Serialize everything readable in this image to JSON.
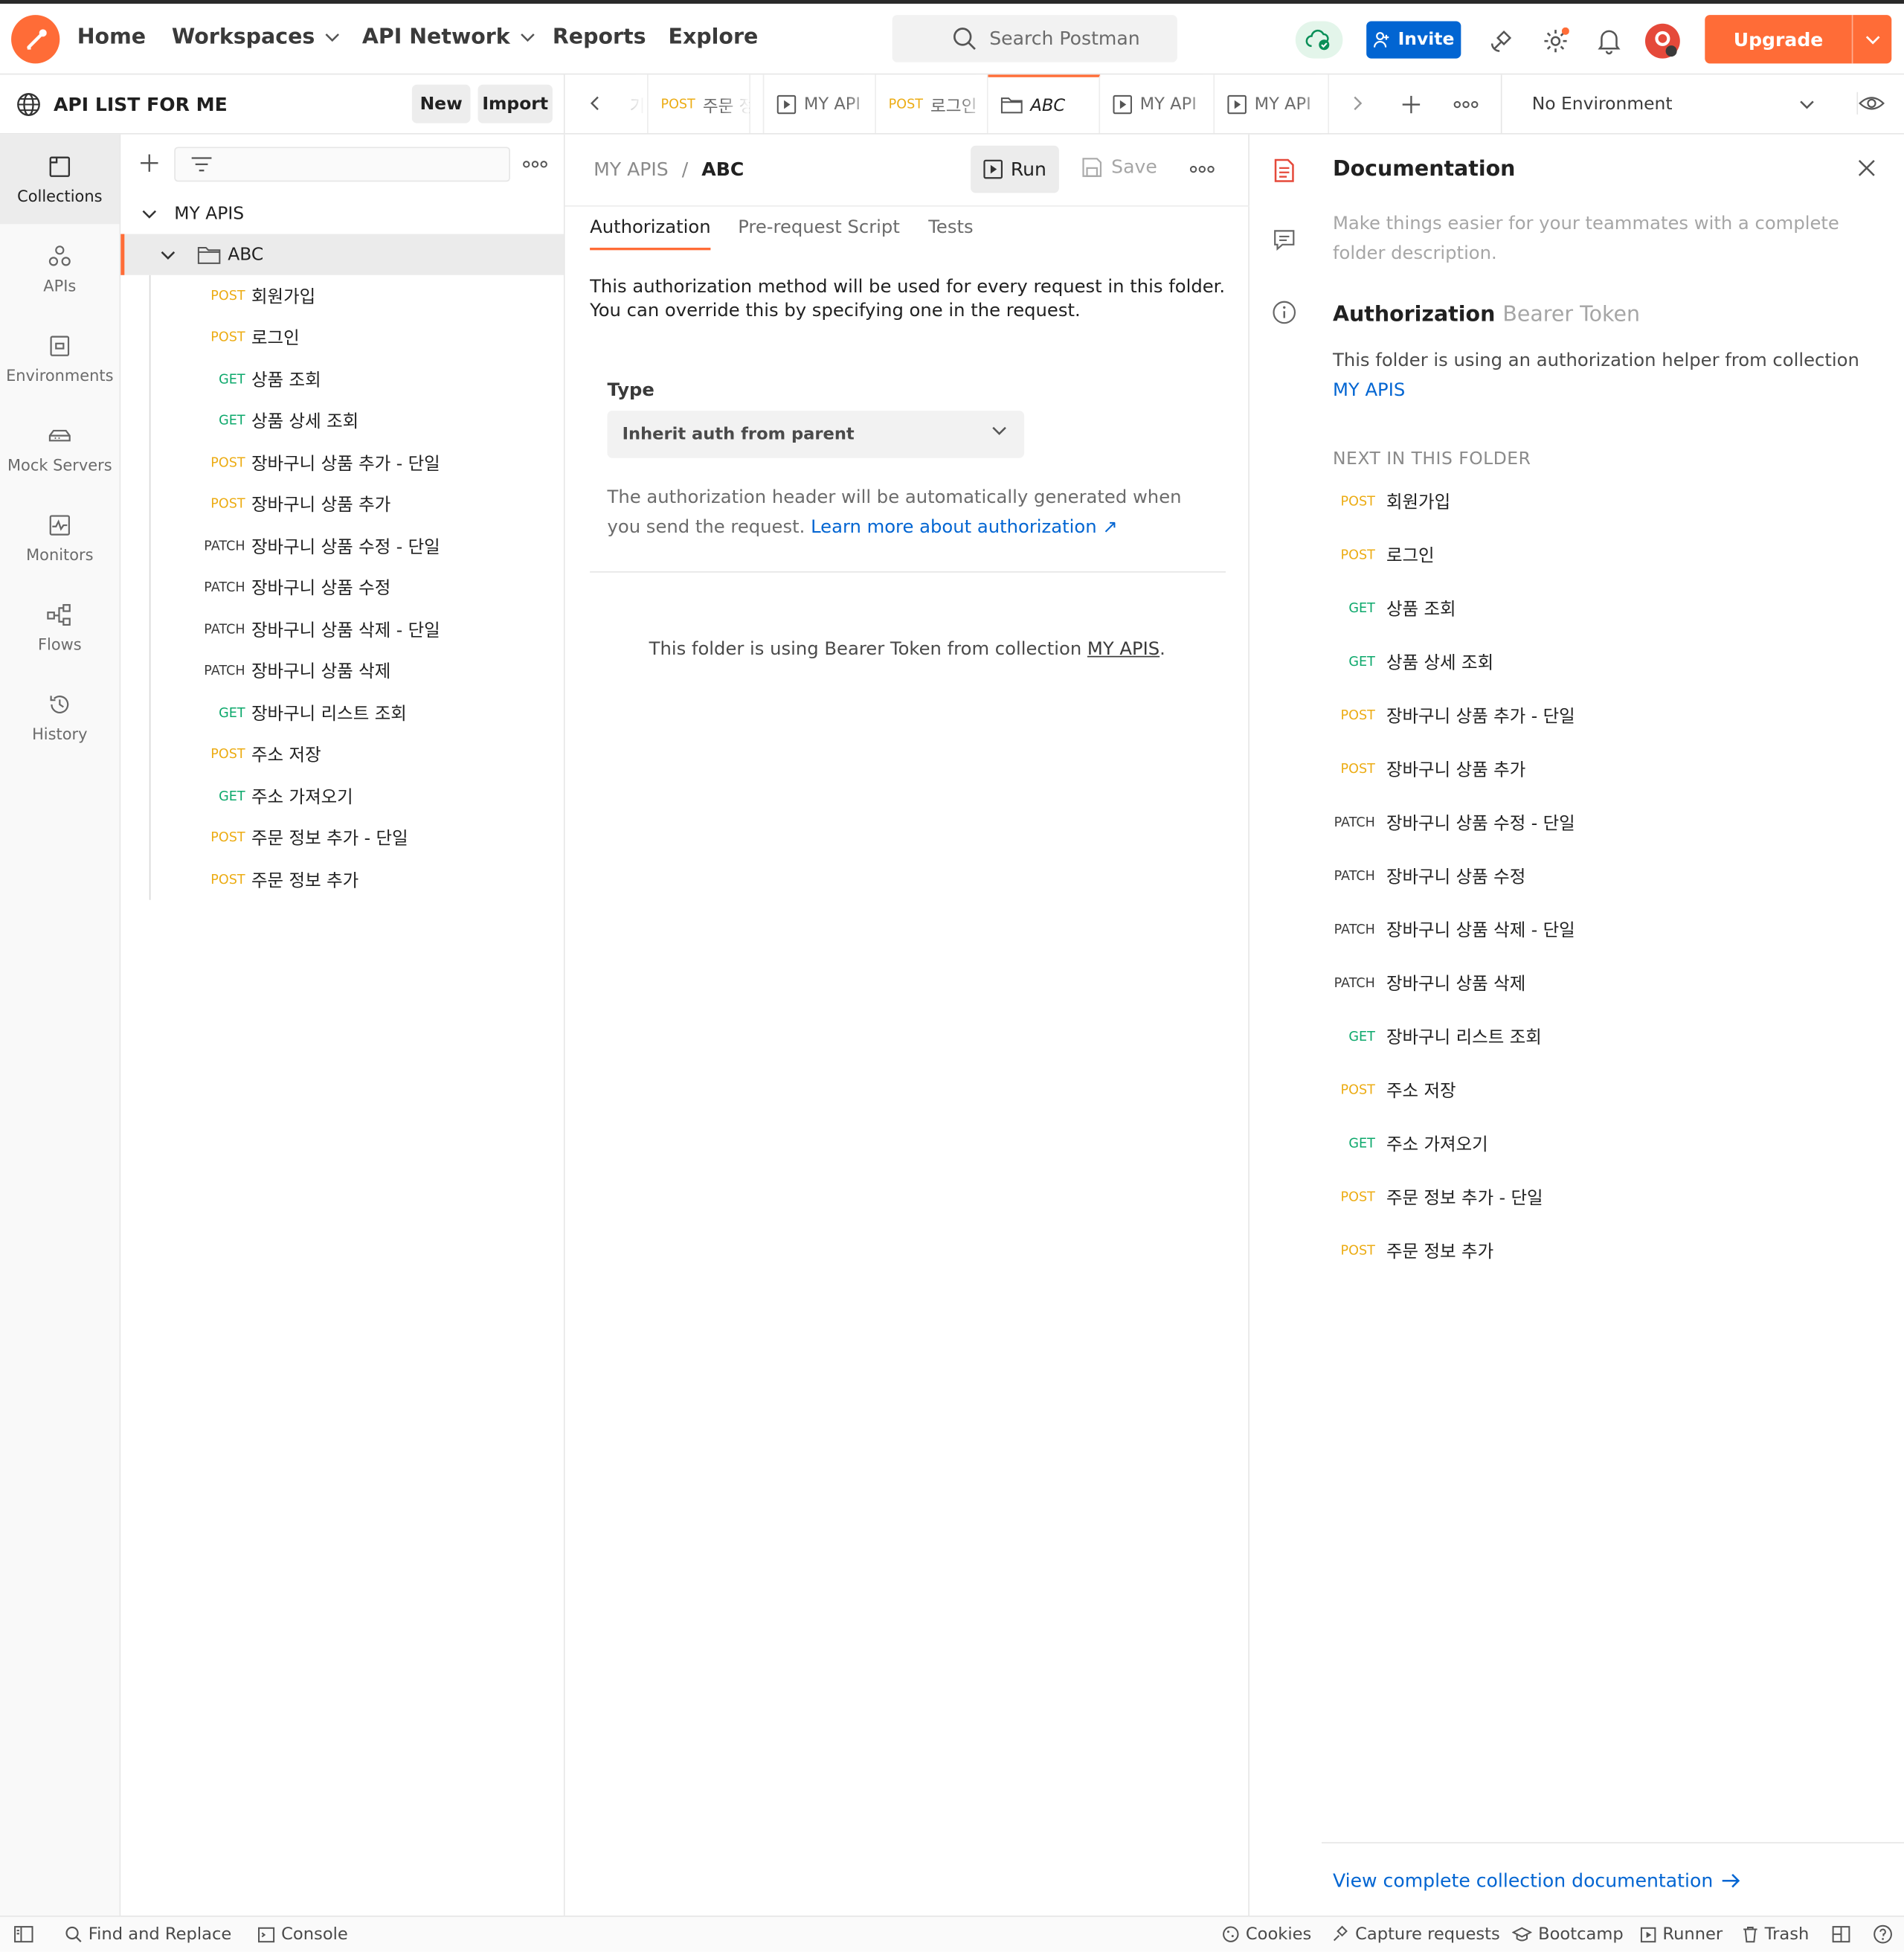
{
  "header": {
    "nav": [
      {
        "label": "Home",
        "dropdown": false
      },
      {
        "label": "Workspaces",
        "dropdown": true
      },
      {
        "label": "API Network",
        "dropdown": true
      },
      {
        "label": "Reports",
        "dropdown": false
      },
      {
        "label": "Explore",
        "dropdown": false
      }
    ],
    "search_placeholder": "Search Postman",
    "invite_label": "Invite",
    "upgrade_label": "Upgrade",
    "colors": {
      "brand": "#ff6c37",
      "primary_blue": "#0265d2"
    }
  },
  "workspace": {
    "title": "API LIST FOR ME",
    "new_label": "New",
    "import_label": "Import"
  },
  "rail": [
    {
      "label": "Collections",
      "icon": "collections-icon",
      "active": true
    },
    {
      "label": "APIs",
      "icon": "apis-icon",
      "active": false
    },
    {
      "label": "Environments",
      "icon": "environments-icon",
      "active": false
    },
    {
      "label": "Mock Servers",
      "icon": "mock-servers-icon",
      "active": false
    },
    {
      "label": "Monitors",
      "icon": "monitors-icon",
      "active": false
    },
    {
      "label": "Flows",
      "icon": "flows-icon",
      "active": false
    },
    {
      "label": "History",
      "icon": "history-icon",
      "active": false
    }
  ],
  "tree": {
    "collection": "MY APIS",
    "folder": "ABC",
    "requests": [
      {
        "method": "POST",
        "name": "회원가입"
      },
      {
        "method": "POST",
        "name": "로그인"
      },
      {
        "method": "GET",
        "name": "상품 조회"
      },
      {
        "method": "GET",
        "name": "상품 상세 조회"
      },
      {
        "method": "POST",
        "name": "장바구니 상품 추가 - 단일"
      },
      {
        "method": "POST",
        "name": "장바구니 상품 추가"
      },
      {
        "method": "PATCH",
        "name": "장바구니 상품 수정 - 단일"
      },
      {
        "method": "PATCH",
        "name": "장바구니 상품 수정"
      },
      {
        "method": "PATCH",
        "name": "장바구니 상품 삭제 - 단일"
      },
      {
        "method": "PATCH",
        "name": "장바구니 상품 삭제"
      },
      {
        "method": "GET",
        "name": "장바구니 리스트 조회"
      },
      {
        "method": "POST",
        "name": "주소 저장"
      },
      {
        "method": "GET",
        "name": "주소 가져오기"
      },
      {
        "method": "POST",
        "name": "주문 정보 추가 - 단일"
      },
      {
        "method": "POST",
        "name": "주문 정보 추가"
      }
    ]
  },
  "tabs": [
    {
      "method": "",
      "label": "기",
      "icon": ""
    },
    {
      "method": "POST",
      "label": "주문 정",
      "icon": ""
    },
    {
      "method": "",
      "label": "MY API",
      "icon": "runner-icon"
    },
    {
      "method": "POST",
      "label": "로그인",
      "icon": ""
    },
    {
      "method": "",
      "label": "ABC",
      "icon": "folder-icon",
      "active": true
    },
    {
      "method": "",
      "label": "MY API",
      "icon": "runner-icon"
    },
    {
      "method": "",
      "label": "MY API",
      "icon": "runner-icon"
    }
  ],
  "environment": {
    "label": "No Environment"
  },
  "main": {
    "breadcrumb_parent": "MY APIS",
    "breadcrumb_sep": "/",
    "breadcrumb_current": "ABC",
    "run_label": "Run",
    "save_label": "Save",
    "subtabs": [
      "Authorization",
      "Pre-request Script",
      "Tests"
    ],
    "description": "This authorization method will be used for every request in this folder. You can override this by specifying one in the request.",
    "type_label": "Type",
    "type_value": "Inherit auth from parent",
    "help_text": "The authorization header will be automatically generated when you send the request.",
    "help_link": "Learn more about authorization ↗",
    "inherit_prefix": "This folder is using Bearer Token from collection",
    "inherit_link": "MY APIS",
    "inherit_suffix": "."
  },
  "docs": {
    "title": "Documentation",
    "placeholder": "Make things easier for your teammates with a complete folder description.",
    "auth_title": "Authorization",
    "auth_type": "Bearer Token",
    "auth_desc": "This folder is using an authorization helper from collection",
    "auth_link": "MY APIS",
    "next_header": "NEXT IN THIS FOLDER",
    "footer_link": "View complete collection documentation"
  },
  "statusbar": {
    "find_replace": "Find and Replace",
    "console": "Console",
    "cookies": "Cookies",
    "capture": "Capture requests",
    "bootcamp": "Bootcamp",
    "runner": "Runner",
    "trash": "Trash"
  }
}
